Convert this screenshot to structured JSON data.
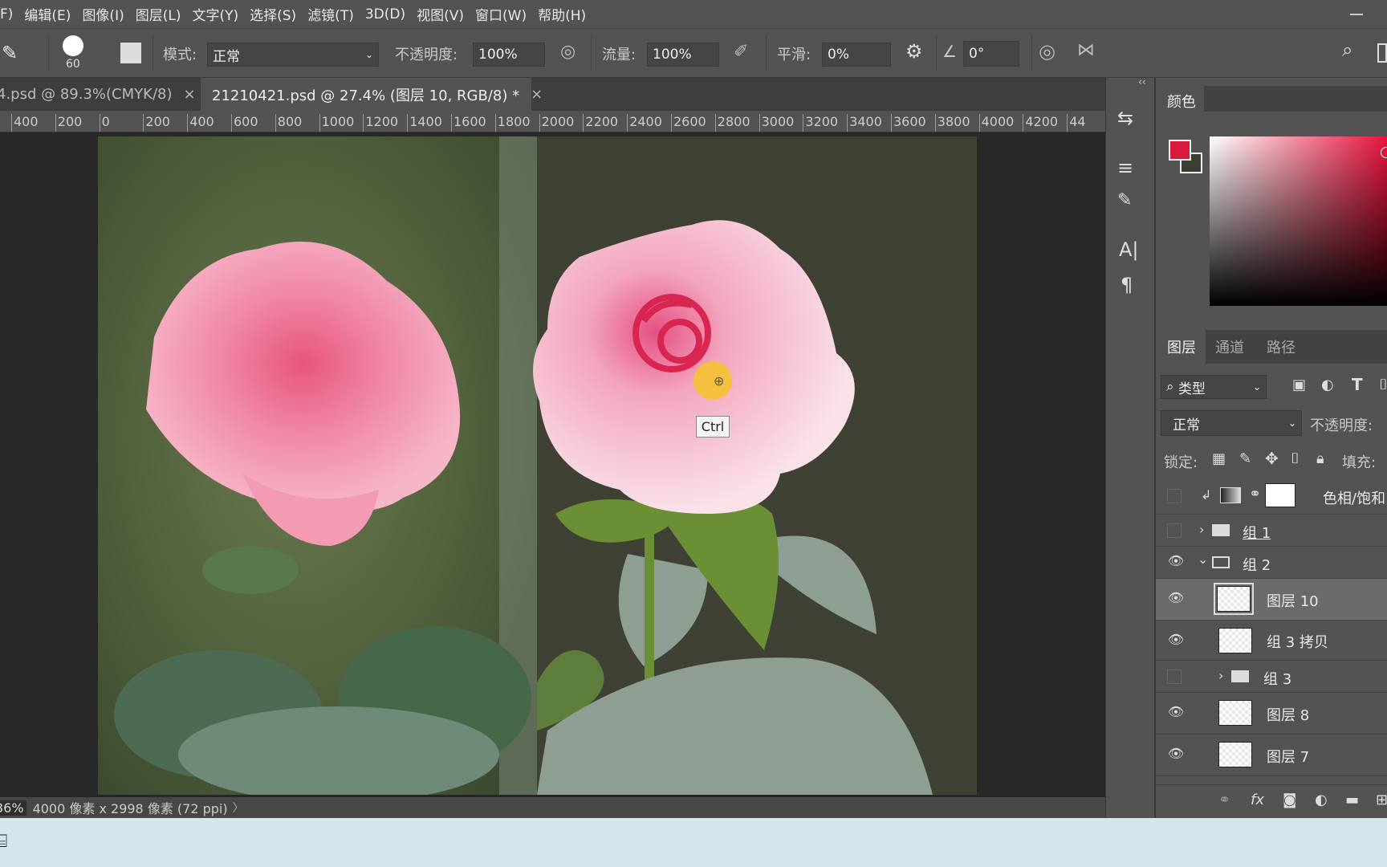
{
  "menu": [
    "F)",
    "编辑(E)",
    "图像(I)",
    "图层(L)",
    "文字(Y)",
    "选择(S)",
    "滤镜(T)",
    "3D(D)",
    "视图(V)",
    "窗口(W)",
    "帮助(H)"
  ],
  "options": {
    "brush_size": "60",
    "mode_label": "模式:",
    "mode_value": "正常",
    "opacity_label": "不透明度:",
    "opacity_value": "100%",
    "flow_label": "流量:",
    "flow_value": "100%",
    "smooth_label": "平滑:",
    "smooth_value": "0%",
    "angle_value": "0°"
  },
  "tabs": [
    {
      "label": "4.psd @ 89.3%(CMYK/8)",
      "active": false
    },
    {
      "label": "21210421.psd @ 27.4% (图层 10, RGB/8) *",
      "active": true
    }
  ],
  "tab_close": "×",
  "ruler": [
    "400",
    "200",
    "0",
    "200",
    "400",
    "600",
    "800",
    "1000",
    "1200",
    "1400",
    "1600",
    "1800",
    "2000",
    "2200",
    "2400",
    "2600",
    "2800",
    "3000",
    "3200",
    "3400",
    "3600",
    "3800",
    "4000",
    "4200",
    "44"
  ],
  "tooltip": "Ctrl",
  "status": {
    "zoom": "36%",
    "info": "4000 像素 x 2998 像素 (72 ppi)",
    "arrow": "〉"
  },
  "colors": {
    "foreground": "#d81b3a",
    "background": "#3c3e32",
    "hue": "#e8103a"
  },
  "color_panel": {
    "tab": "颜色"
  },
  "layers_panel": {
    "tabs": [
      "图层",
      "通道",
      "路径"
    ],
    "filter": "类型",
    "blend": "正常",
    "opacity_label": "不透明度:",
    "lock_label": "锁定:",
    "fill_label": "填充:",
    "layers": [
      {
        "name": "色相/饱和",
        "visible": false,
        "type": "adjustment"
      },
      {
        "name": "组 1",
        "visible": false,
        "type": "group",
        "expanded": false
      },
      {
        "name": "组 2",
        "visible": true,
        "type": "group",
        "expanded": true
      },
      {
        "name": "图层 10",
        "visible": true,
        "type": "layer",
        "selected": true
      },
      {
        "name": "组 3 拷贝",
        "visible": true,
        "type": "layer"
      },
      {
        "name": "组 3",
        "visible": false,
        "type": "group",
        "expanded": false
      },
      {
        "name": "图层 8",
        "visible": true,
        "type": "layer"
      },
      {
        "name": "图层 7",
        "visible": true,
        "type": "layer"
      }
    ],
    "footer_icons": [
      "link-icon",
      "fx-icon",
      "mask-icon",
      "adjustment-icon",
      "folder-icon",
      "new-layer-icon"
    ]
  },
  "dock_icons": [
    "history-icon",
    "brush-settings-icon",
    "brush-presets-icon",
    "character-icon",
    "paragraph-icon"
  ]
}
